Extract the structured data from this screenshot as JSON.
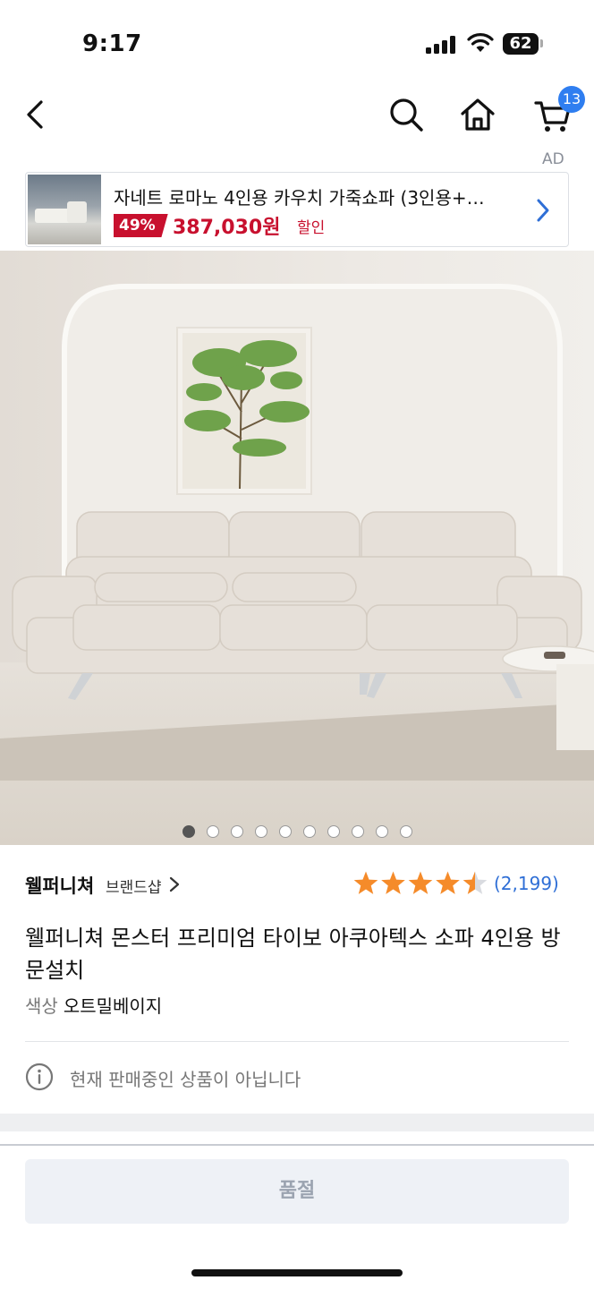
{
  "status_bar": {
    "time": "9:17",
    "battery": "62"
  },
  "nav": {
    "cart_count": "13",
    "ad_label": "AD"
  },
  "ad_banner": {
    "title": "자네트 로마노 4인용 카우치 가죽쇼파 (3인용+…",
    "discount": "49%",
    "price": "387,030원",
    "price_suffix": "할인"
  },
  "gallery": {
    "total_images": 10,
    "active_index": 0
  },
  "product": {
    "brand": "웰퍼니쳐",
    "brand_shop_label": "브랜드샵",
    "rating": 4.5,
    "review_count": "(2,199)",
    "title": "웰퍼니쳐 몬스터 프리미엄 타이보 아쿠아텍스 소파 4인용 방문설치",
    "option_label": "색상",
    "option_value": "오트밀베이지",
    "notice": "현재 판매중인 상품이 아닙니다"
  },
  "bottom": {
    "soldout_label": "품절"
  },
  "colors": {
    "accent_blue": "#2f7ef0",
    "sale_red": "#c8102e",
    "star_orange": "#f58b2a"
  }
}
